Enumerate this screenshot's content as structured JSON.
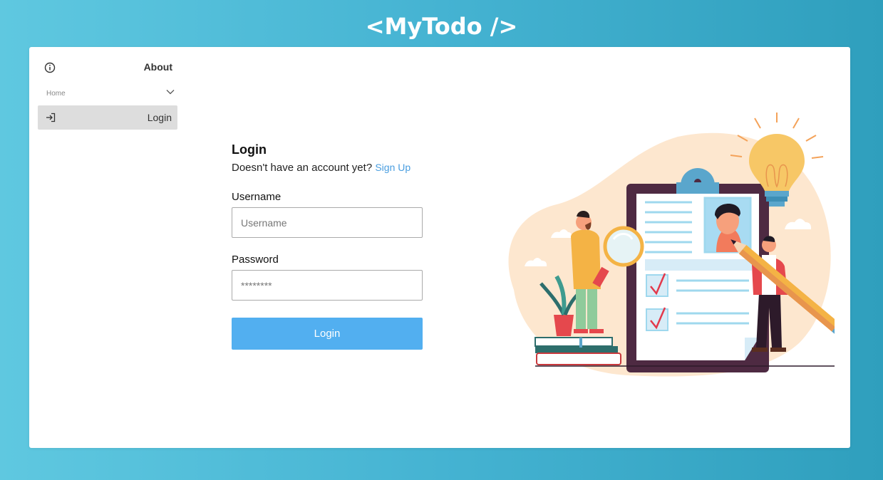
{
  "app": {
    "title": "<MyTodo />"
  },
  "sidebar": {
    "about_label": "About",
    "home_label": "Home",
    "items": [
      {
        "label": "Login",
        "icon": "login-icon",
        "active": true
      }
    ]
  },
  "login_form": {
    "title": "Login",
    "signup_prompt": "Doesn't have an account yet?",
    "signup_link": "Sign Up",
    "username_label": "Username",
    "username_placeholder": "Username",
    "password_label": "Password",
    "password_placeholder": "********",
    "submit_label": "Login"
  },
  "colors": {
    "background_start": "#5fc8e0",
    "background_end": "#2f9fbd",
    "button": "#52aff0",
    "link": "#4a9ee0",
    "active_item": "#dddddd"
  }
}
